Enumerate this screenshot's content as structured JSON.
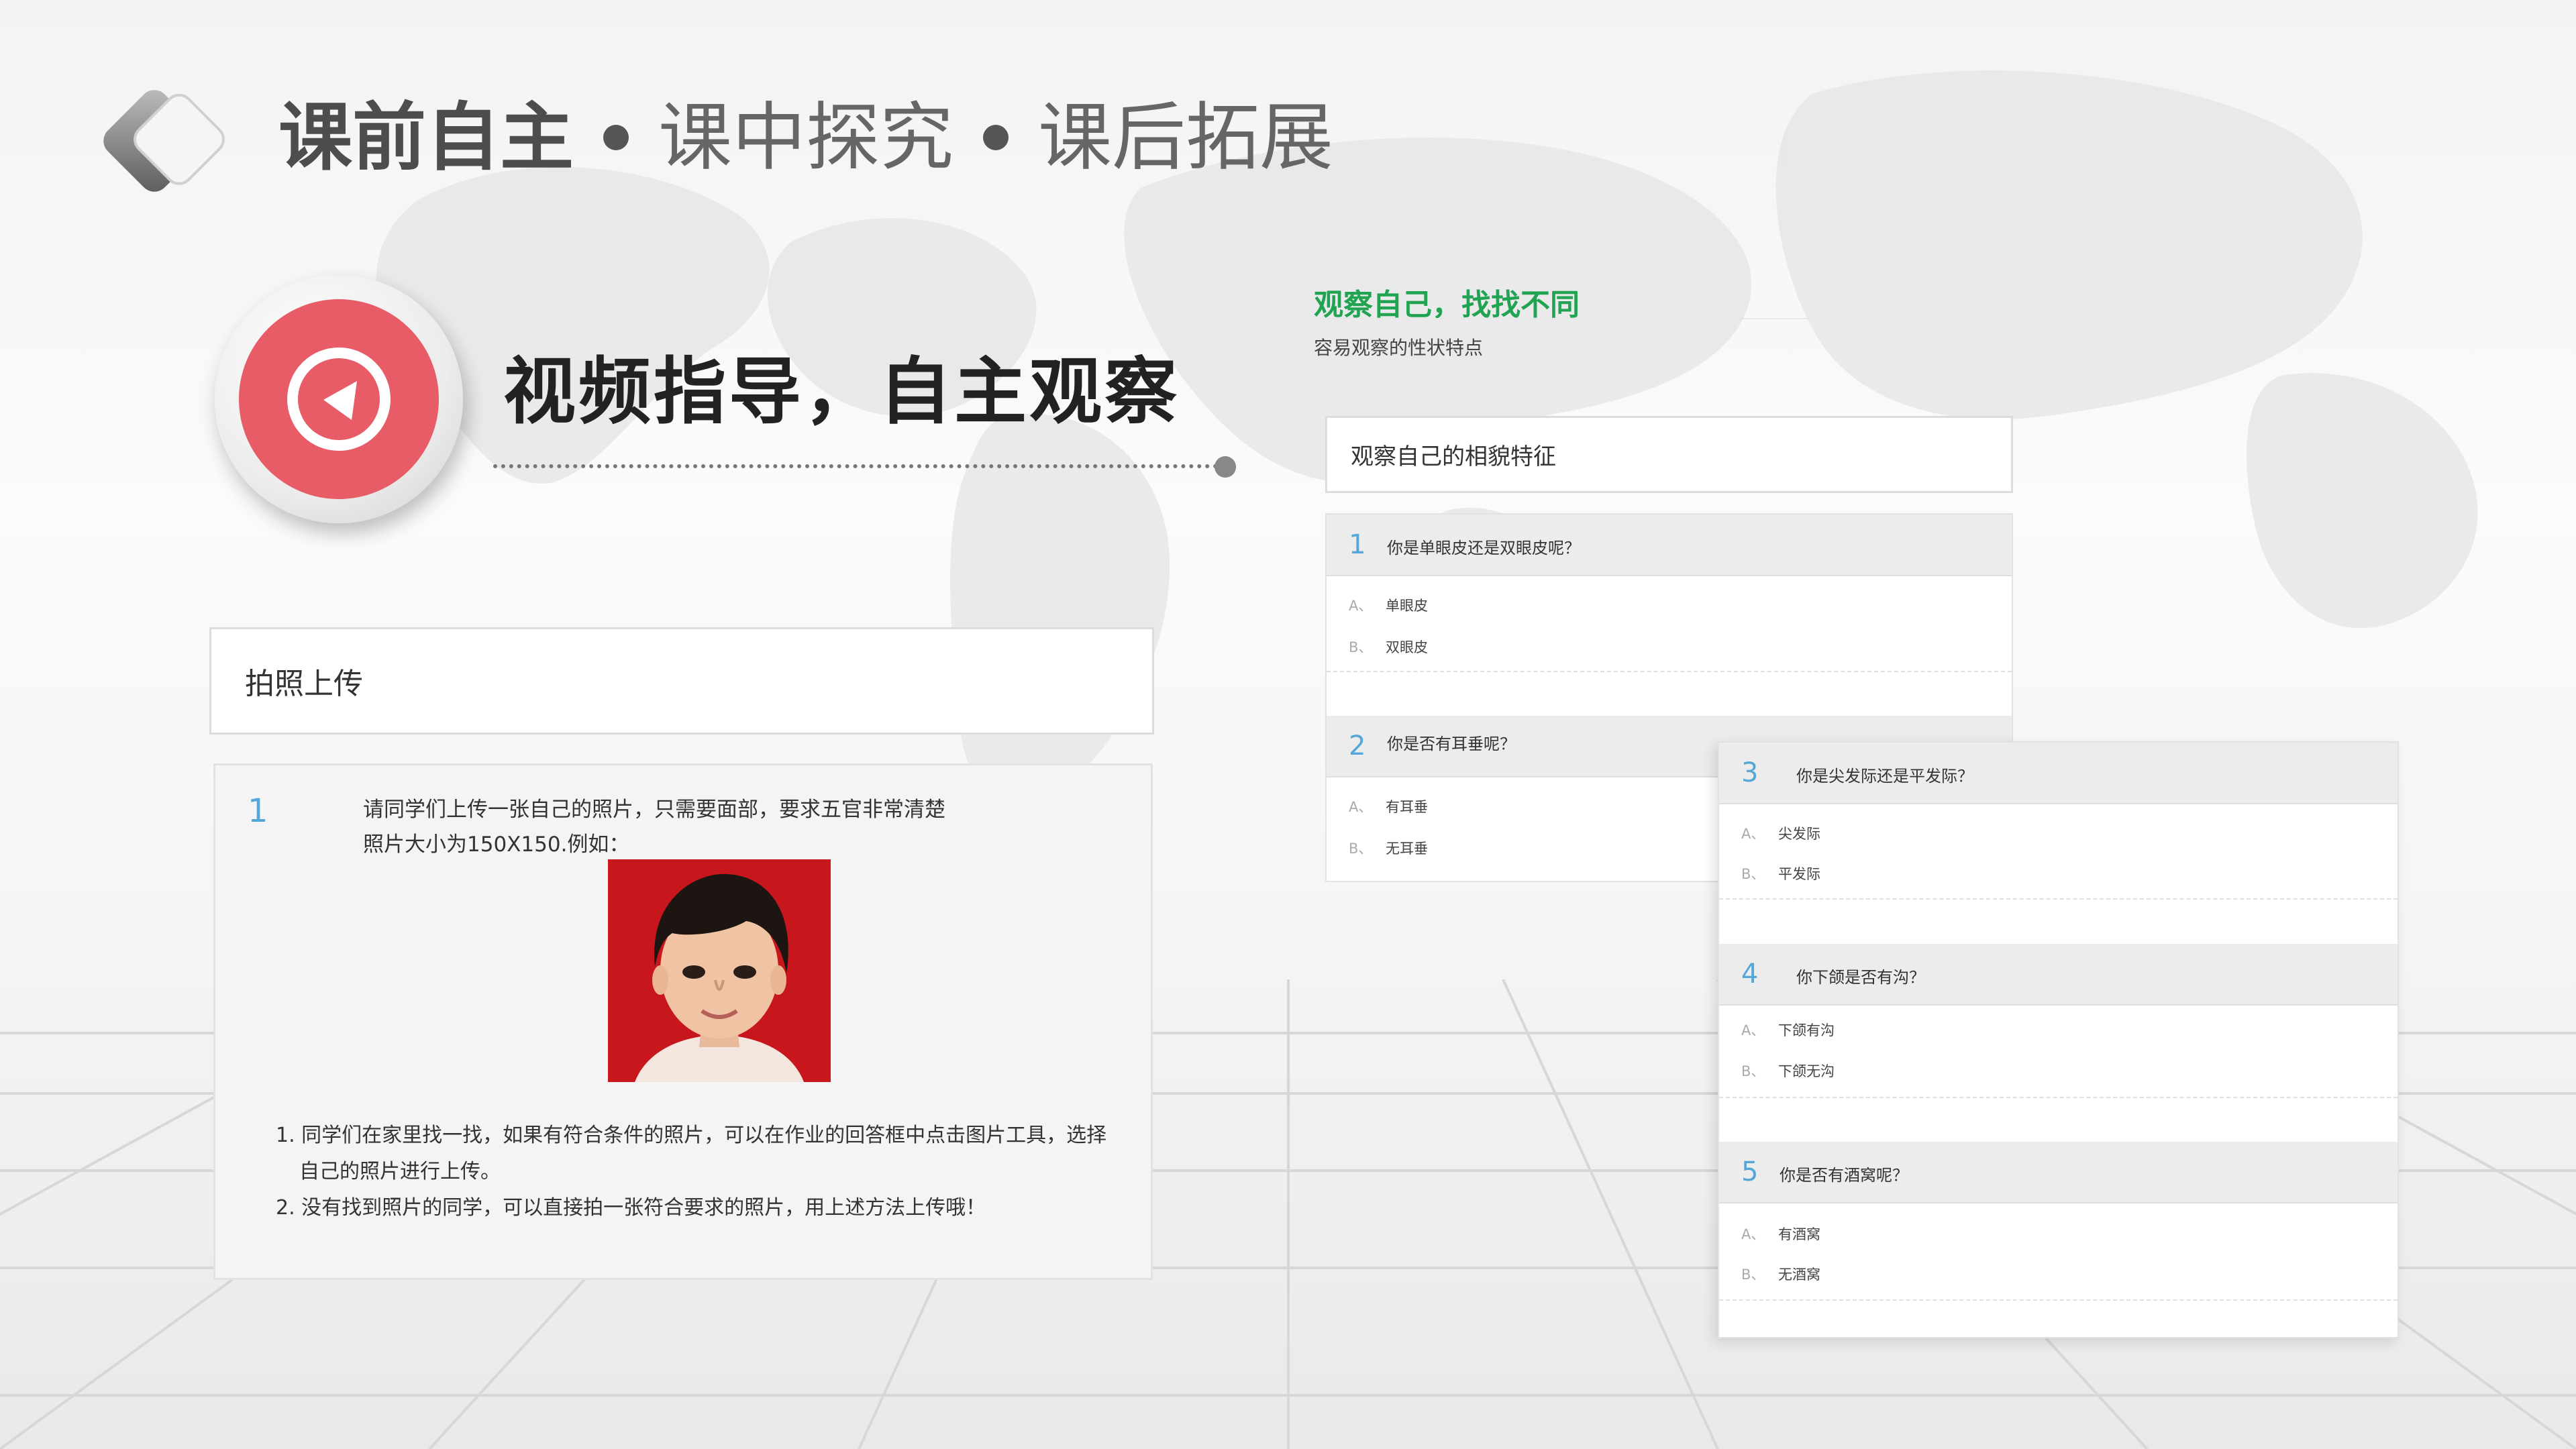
{
  "header": {
    "items": [
      "课前自主",
      "课中探究",
      "课后拓展"
    ],
    "active_index": 0
  },
  "section": {
    "title": "视频指导，自主观察",
    "icon": "play-triangle-icon",
    "accent": "#e75c66"
  },
  "upload": {
    "heading": "拍照上传",
    "number": "1",
    "instruction_line1": "请同学们上传一张自己的照片，只需要面部，要求五官非常清楚",
    "instruction_line2": "照片大小为150X150.例如：",
    "notes": [
      "1. 同学们在家里找一找，如果有符合条件的照片，可以在作业的回答框中点击图片工具，选择",
      "   自己的照片进行上传。",
      "2. 没有找到照片的同学，可以直接拍一张符合要求的照片，用上述方法上传哦！"
    ]
  },
  "survey": {
    "title": "观察自己，找找不同",
    "subtitle": "容易观察的性状特点",
    "box_label": "观察自己的相貌特征",
    "accent": "#21a452",
    "questions": [
      {
        "num": "1",
        "text": "你是单眼皮还是双眼皮呢？",
        "options": [
          {
            "letter": "A、",
            "text": "单眼皮"
          },
          {
            "letter": "B、",
            "text": "双眼皮"
          }
        ]
      },
      {
        "num": "2",
        "text": "你是否有耳垂呢？",
        "options": [
          {
            "letter": "A、",
            "text": "有耳垂"
          },
          {
            "letter": "B、",
            "text": "无耳垂"
          }
        ]
      },
      {
        "num": "3",
        "text": "你是尖发际还是平发际？",
        "options": [
          {
            "letter": "A、",
            "text": "尖发际"
          },
          {
            "letter": "B、",
            "text": "平发际"
          }
        ]
      },
      {
        "num": "4",
        "text": "你下颌是否有沟？",
        "options": [
          {
            "letter": "A、",
            "text": "下颌有沟"
          },
          {
            "letter": "B、",
            "text": "下颌无沟"
          }
        ]
      },
      {
        "num": "5",
        "text": "你是否有酒窝呢？",
        "options": [
          {
            "letter": "A、",
            "text": "有酒窝"
          },
          {
            "letter": "B、",
            "text": "无酒窝"
          }
        ]
      }
    ]
  }
}
